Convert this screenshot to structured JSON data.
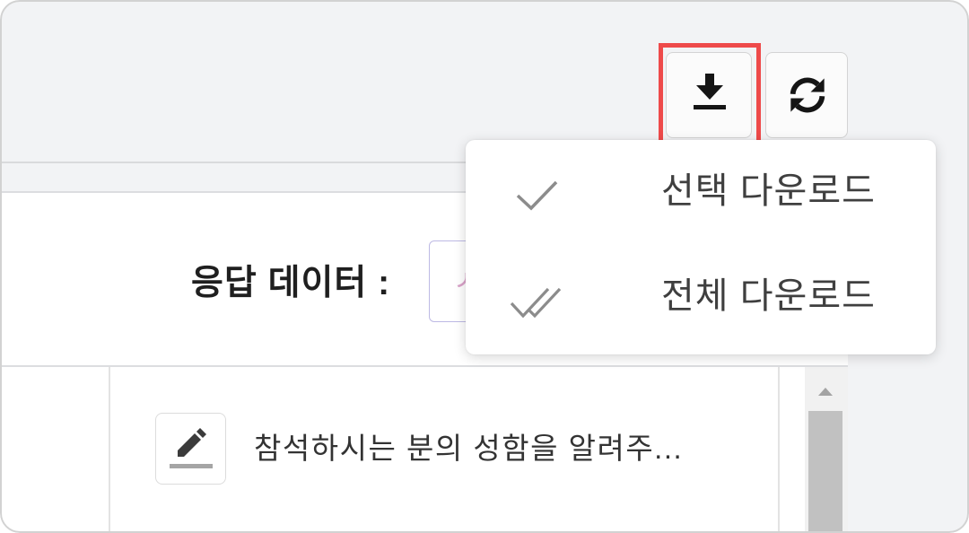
{
  "toolbar": {
    "download_button": {
      "icon": "download-icon",
      "highlighted": true
    },
    "refresh_button": {
      "icon": "sync-icon"
    }
  },
  "download_menu": {
    "items": [
      {
        "icon": "check-icon",
        "label": "선택 다운로드"
      },
      {
        "icon": "double-check-icon",
        "label": "전체 다운로드"
      }
    ]
  },
  "filter": {
    "label": "응답 데이터 :",
    "select_value": "ㅅ"
  },
  "table": {
    "rows": [
      {
        "edit_icon": "pencil-icon",
        "question": "참석하시는 분의 성함을 알려주..."
      }
    ],
    "scrollbar": {
      "up_icon": "triangle-up-icon"
    }
  },
  "colors": {
    "page_background": "#f2f3f5",
    "panel_background": "#ffffff",
    "highlight": "#ee4a4a",
    "select_border": "#bdb9e4",
    "select_text": "#d9a3c9",
    "menu_icon": "#8c8c8c",
    "scroll_thumb": "#c1c1c1"
  }
}
